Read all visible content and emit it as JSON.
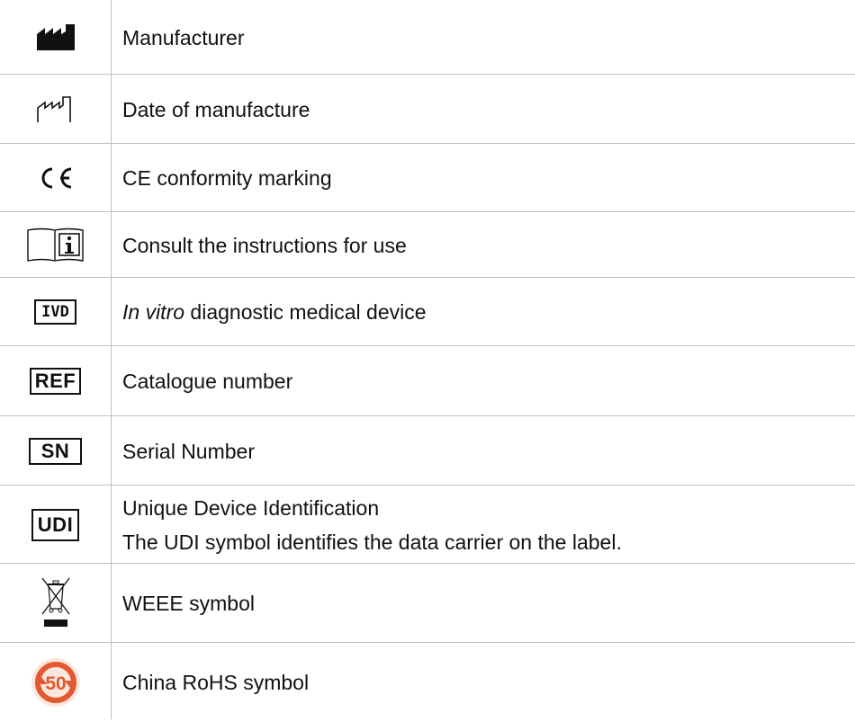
{
  "rows": [
    {
      "icon": "manufacturer-icon",
      "text": "Manufacturer"
    },
    {
      "icon": "date-of-manufacture-icon",
      "text": "Date of manufacture"
    },
    {
      "icon": "ce-marking-icon",
      "text": "CE conformity marking"
    },
    {
      "icon": "instructions-for-use-icon",
      "text": "Consult the instructions for use"
    },
    {
      "icon": "ivd-icon",
      "label": "IVD",
      "text_italic": "In vitro",
      "text": " diagnostic medical device"
    },
    {
      "icon": "ref-icon",
      "label": "REF",
      "text": "Catalogue number"
    },
    {
      "icon": "sn-icon",
      "label": "SN",
      "text": "Serial Number"
    },
    {
      "icon": "udi-icon",
      "label": "UDI",
      "text": "Unique Device Identification",
      "text2": "The UDI symbol identifies the data carrier on the label."
    },
    {
      "icon": "weee-icon",
      "text": "WEEE symbol"
    },
    {
      "icon": "china-rohs-icon",
      "label": "50",
      "text": "China RoHS symbol"
    }
  ],
  "colors": {
    "rohs_orange": "#e2582f",
    "grid": "#bfbfbf"
  }
}
